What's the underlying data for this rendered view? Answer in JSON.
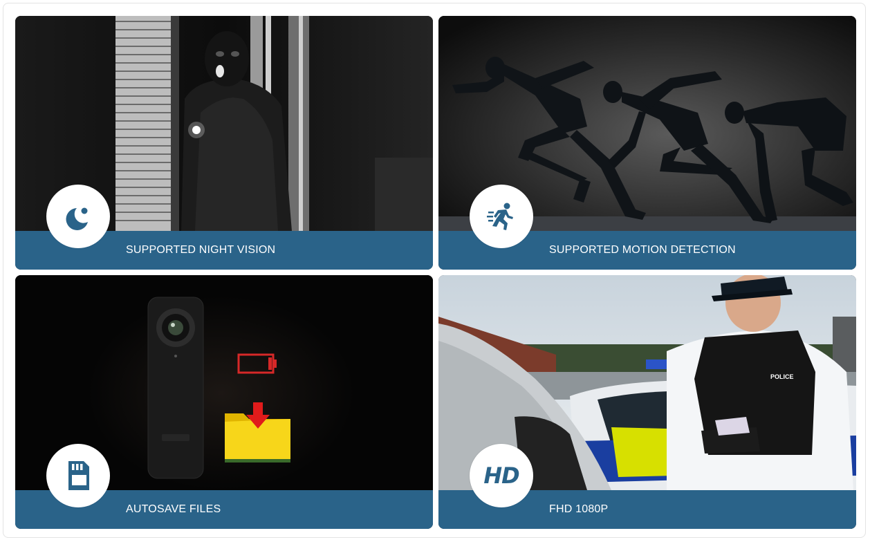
{
  "features": [
    {
      "caption": "SUPPORTED NIGHT VISION",
      "icon": "moon-icon"
    },
    {
      "caption": "SUPPORTED MOTION DETECTION",
      "icon": "running-person-icon"
    },
    {
      "caption": "AUTOSAVE FILES",
      "icon": "sd-card-icon"
    },
    {
      "caption": "FHD 1080P",
      "icon": "hd-icon",
      "icon_text": "HD"
    }
  ],
  "scene_text": {
    "police_vest": "POLICE"
  },
  "colors": {
    "accent": "#2a6389",
    "badge_bg": "#ffffff",
    "caption_text": "#ffffff"
  }
}
